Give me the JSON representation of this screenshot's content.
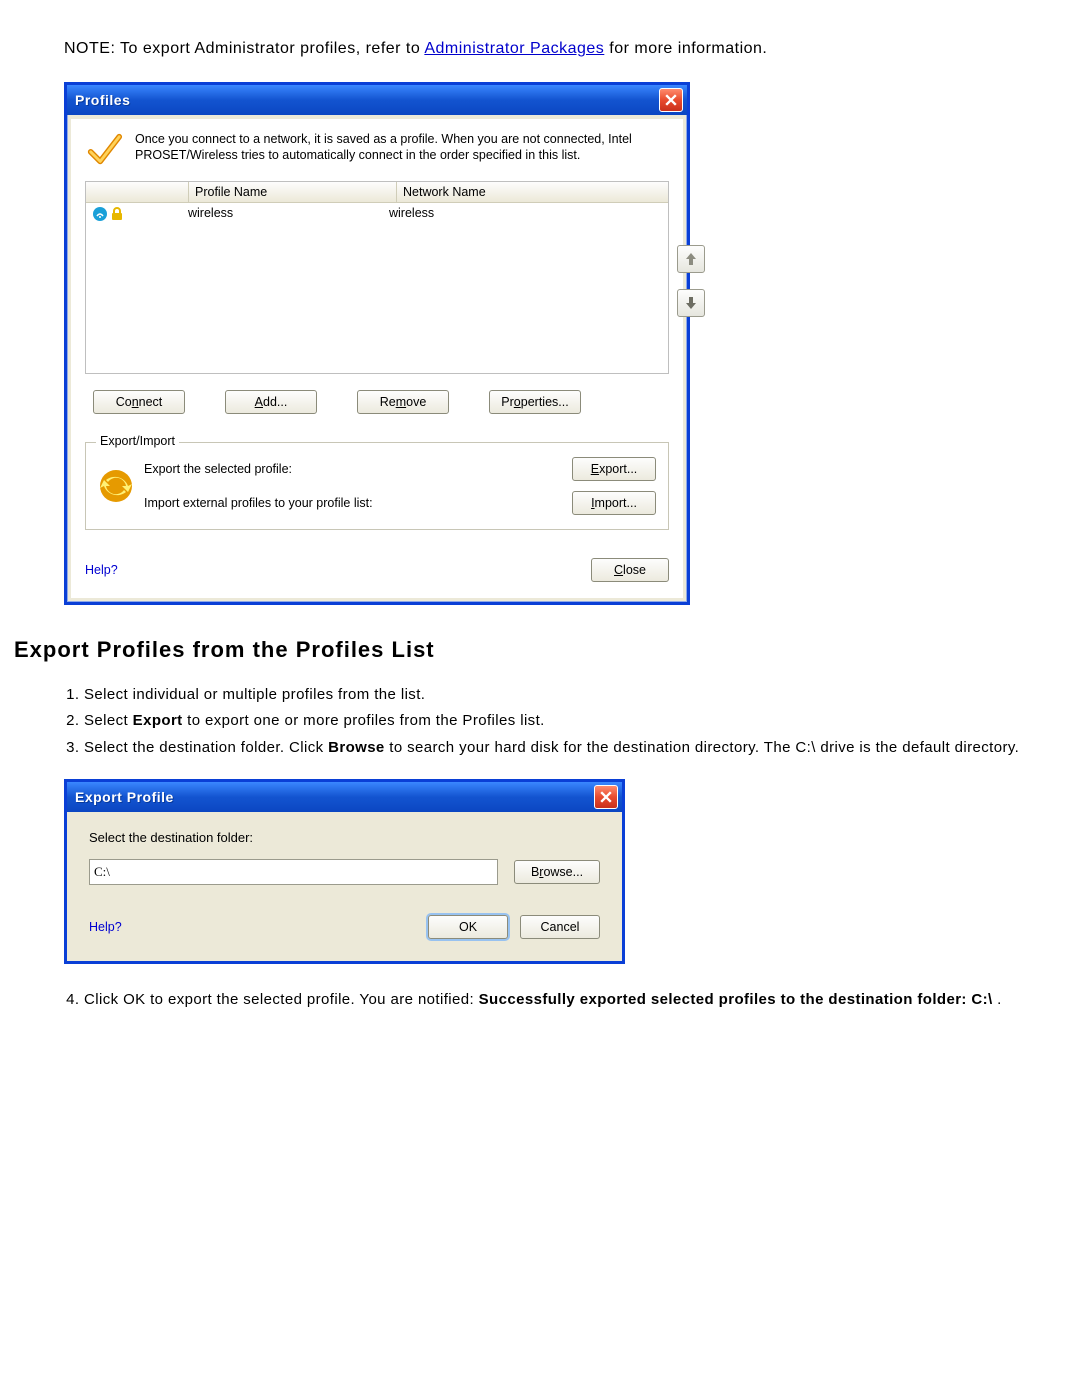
{
  "note": {
    "prefix": "NOTE: To export Administrator profiles, refer to ",
    "link": "Administrator Packages",
    "suffix": " for more information."
  },
  "dialog1": {
    "title": "Profiles",
    "intro": "Once you connect to a network, it is saved as a profile. When you are not connected, Intel PROSET/Wireless tries to automatically connect in the order specified in this list.",
    "headers": {
      "profile": "Profile Name",
      "network": "Network Name"
    },
    "row": {
      "profile": "wireless",
      "network": "wireless"
    },
    "buttons": {
      "connect": "Connect",
      "add": "Add...",
      "remove": "Remove",
      "properties": "Properties..."
    },
    "group": {
      "label": "Export/Import",
      "exportLabel": "Export the selected profile:",
      "exportBtn": "Export...",
      "importLabel": "Import external profiles to your profile list:",
      "importBtn": "Import..."
    },
    "help": "Help?",
    "close": "Close"
  },
  "section": {
    "title": "Export Profiles from the Profiles List",
    "step1": "Select individual or multiple profiles from the list.",
    "step2a": "Select ",
    "step2b": "Export",
    "step2c": " to export one or more profiles from the Profiles list.",
    "step3a": "Select the destination folder. Click ",
    "step3b": "Browse",
    "step3c": " to search your hard disk for the destination directory. The C:\\ drive is the default directory.",
    "step4a": "Click OK to export the selected profile. You are notified: ",
    "step4b": "Successfully exported selected profiles to the destination folder: C:\\",
    "step4c": " ."
  },
  "dialog2": {
    "title": "Export Profile",
    "destLabel": "Select the destination folder:",
    "folder": "C:\\",
    "browse": "Browse...",
    "help": "Help?",
    "ok": "OK",
    "cancel": "Cancel"
  }
}
